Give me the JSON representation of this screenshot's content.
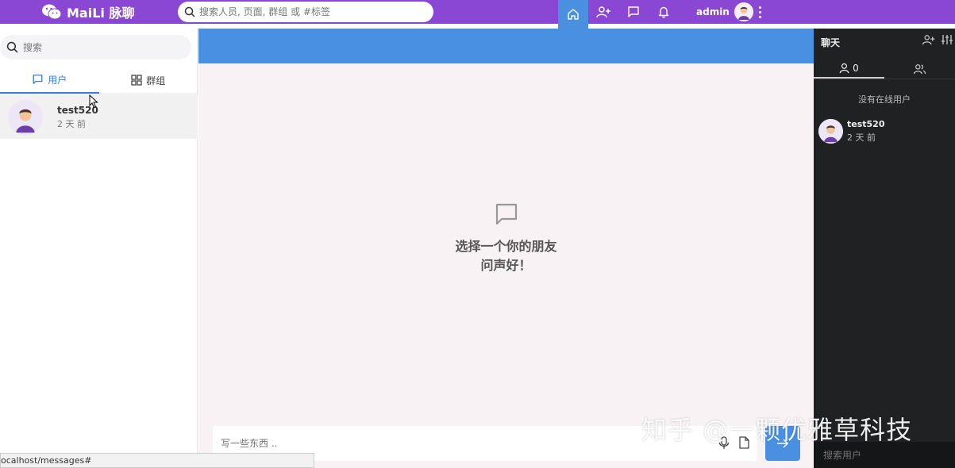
{
  "topbar": {
    "brand": "MaiLi 脉聊",
    "search_placeholder": "搜索人员, 页面, 群组 或 #标签",
    "username": "admin"
  },
  "sidebar": {
    "search_placeholder": "搜索",
    "tabs": [
      {
        "label": "用户",
        "active": true
      },
      {
        "label": "群组",
        "active": false
      }
    ],
    "contacts": [
      {
        "name": "test520",
        "time": "2 天 前"
      }
    ]
  },
  "center": {
    "empty_line1": "选择一个你的朋友",
    "empty_line2": "问声好！",
    "composer_placeholder": "写一些东西 .."
  },
  "status_url": "ocalhost/messages#",
  "rightpanel": {
    "title": "聊天",
    "online_count": "0",
    "no_online": "没有在线用户",
    "users": [
      {
        "name": "test520",
        "time": "2 天 前"
      }
    ],
    "search_placeholder": "搜索用户"
  },
  "watermark": "知乎 @一颗优雅草科技",
  "colors": {
    "topbar": "#8a47d3",
    "accent": "#4a90e2",
    "right_panel": "#1f2122"
  }
}
